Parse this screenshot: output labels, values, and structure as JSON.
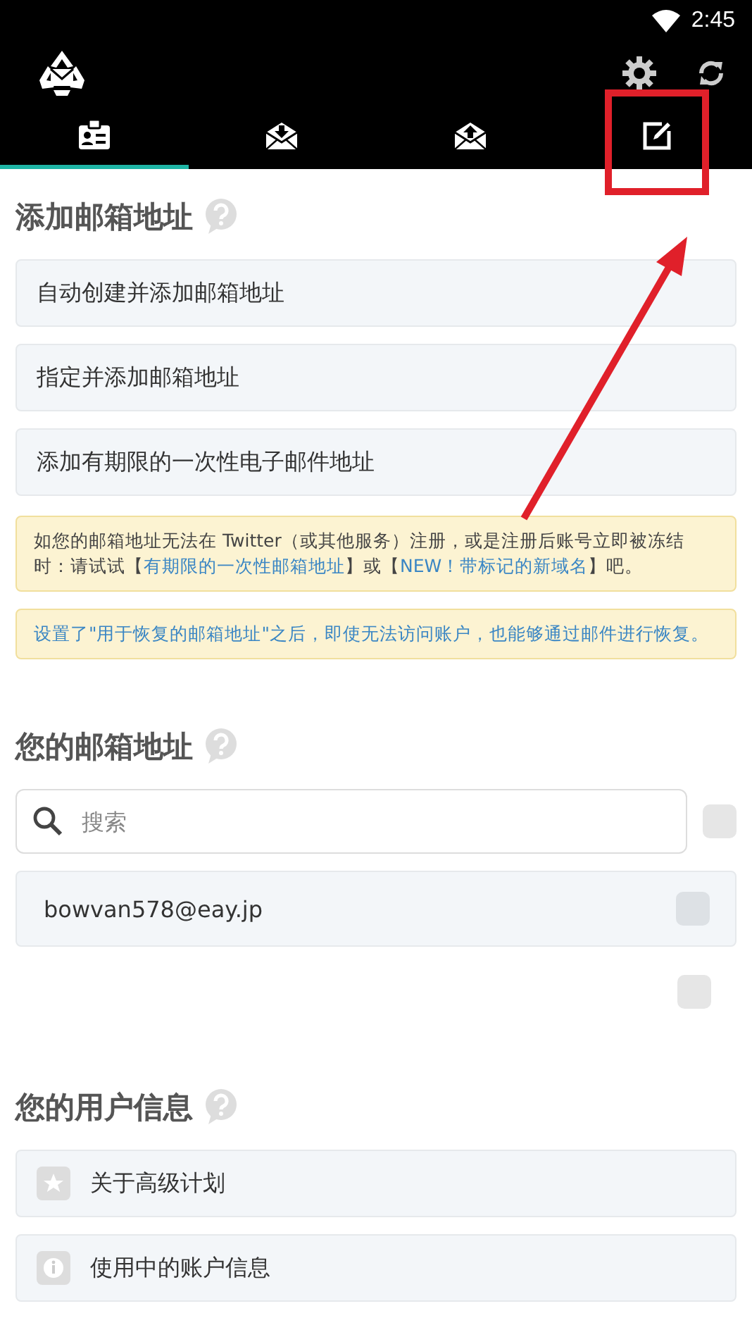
{
  "status_bar": {
    "time": "2:45"
  },
  "tabs": [
    {
      "kind": "profile",
      "selected": true
    },
    {
      "kind": "inbox",
      "selected": false
    },
    {
      "kind": "outbox",
      "selected": false
    },
    {
      "kind": "compose",
      "selected": false
    }
  ],
  "add_section": {
    "title": "添加邮箱地址",
    "actions": [
      "自动创建并添加邮箱地址",
      "指定并添加邮箱地址",
      "添加有期限的一次性电子邮件地址"
    ],
    "notices": [
      {
        "segments": [
          {
            "text": "如您的邮箱地址无法在 Twitter（或其他服务）注册，或是注册后账号立即被冻结时：请试试【",
            "link": false
          },
          {
            "text": "有期限的一次性邮箱地址",
            "link": true
          },
          {
            "text": "】或【",
            "link": false
          },
          {
            "text": "NEW！带标记的新域名",
            "link": true
          },
          {
            "text": "】吧。",
            "link": false
          }
        ]
      },
      {
        "segments": [
          {
            "text": "设置了\"用于恢复的邮箱地址\"之后，即使无法访问账户，也能够通过邮件进行恢复。",
            "link": true
          }
        ]
      }
    ]
  },
  "address_section": {
    "title": "您的邮箱地址",
    "search": {
      "placeholder": "搜索",
      "checked": false
    },
    "addresses": [
      {
        "address": "bowvan578@eay.jp",
        "checked": false
      }
    ],
    "extra_checkbox": {
      "checked": false
    }
  },
  "user_section": {
    "title": "您的用户信息",
    "items": [
      {
        "kind": "star",
        "label": "关于高级计划"
      },
      {
        "kind": "info",
        "label": "使用中的账户信息"
      }
    ]
  },
  "annotation": {
    "kind": "highlight-arrow"
  }
}
